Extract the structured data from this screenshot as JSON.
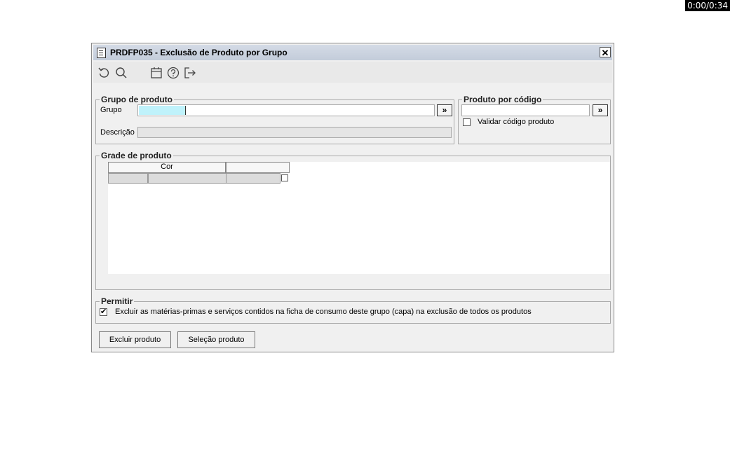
{
  "timer": "0:00/0:34",
  "window": {
    "title": "PRDFP035 - Exclusão de Produto por Grupo",
    "close_label": "✕"
  },
  "toolbar": {
    "icons": [
      "undo-icon",
      "search-icon",
      "calendar-icon",
      "help-icon",
      "exit-icon"
    ]
  },
  "grupo_produto": {
    "legend": "Grupo de produto",
    "grupo_label": "Grupo",
    "grupo_value": "",
    "more_label": "»",
    "descricao_label": "Descrição",
    "descricao_value": ""
  },
  "produto_codigo": {
    "legend": "Produto por código",
    "value": "",
    "more_label": "»",
    "validar_label": "Validar código produto",
    "validar_checked": false
  },
  "grade": {
    "legend": "Grade de produto",
    "columns": [
      "Cor",
      ""
    ]
  },
  "permitir": {
    "legend": "Permitir",
    "option_label": "Excluir as matérias-primas e serviços contidos na ficha de consumo deste grupo (capa) na exclusão de todos os produtos",
    "option_checked": true
  },
  "buttons": {
    "excluir": "Excluir produto",
    "selecao": "Seleção produto"
  }
}
